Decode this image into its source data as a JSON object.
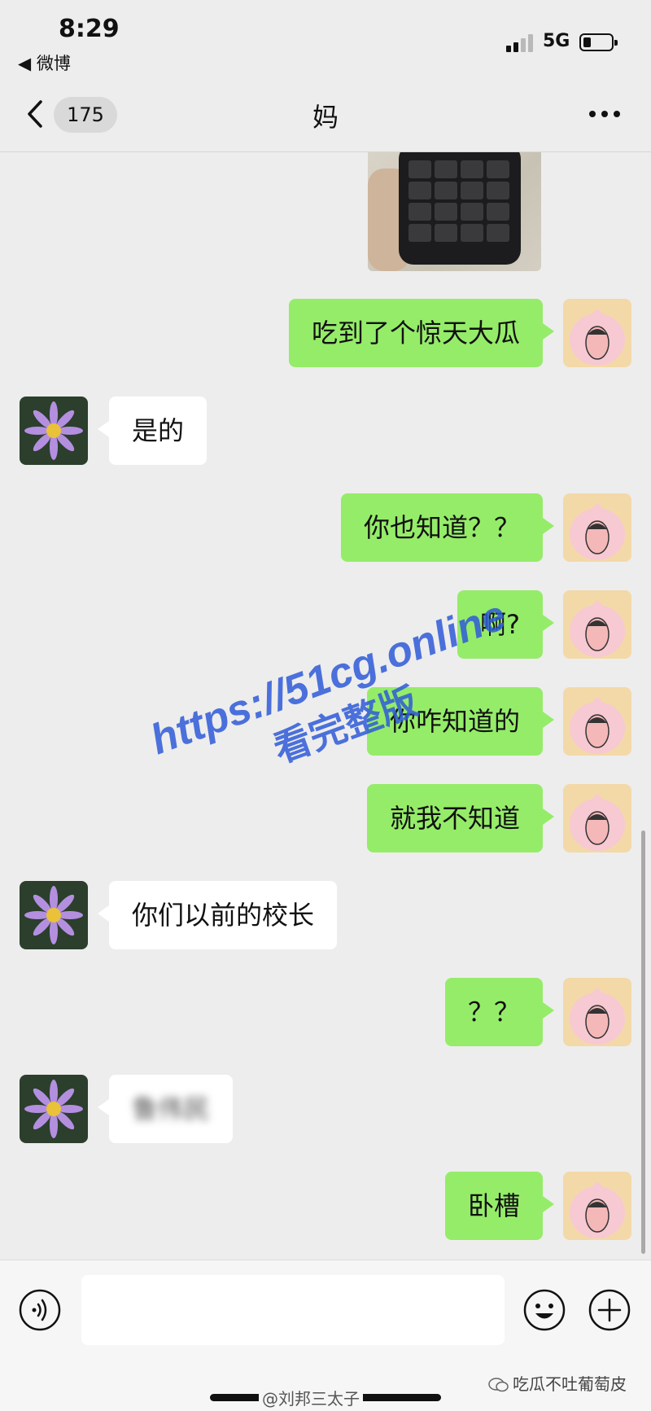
{
  "status_bar": {
    "time": "8:29",
    "back_app": "◀ 微博",
    "network": "5G",
    "signal_bars": 2,
    "signal_bars_total": 4,
    "battery_fraction": 0.25
  },
  "nav": {
    "unread_count": "175",
    "title": "妈",
    "back_icon": "chevron-left-icon",
    "more_icon": "more-dots-icon"
  },
  "messages": [
    {
      "side": "out",
      "text": "吃到了个惊天大瓜"
    },
    {
      "side": "in",
      "text": "是的"
    },
    {
      "side": "out",
      "text": "你也知道？？"
    },
    {
      "side": "out",
      "text": "啊?"
    },
    {
      "side": "out",
      "text": "你咋知道的"
    },
    {
      "side": "out",
      "text": "就我不知道"
    },
    {
      "side": "in",
      "text": "你们以前的校长"
    },
    {
      "side": "out",
      "text": "？？"
    },
    {
      "side": "in",
      "text": "鲁伟民",
      "blurred": true
    },
    {
      "side": "out",
      "text": "卧槽"
    }
  ],
  "watermark": {
    "url": "https://51cg.online",
    "slogan": "看完整版"
  },
  "input_bar": {
    "placeholder": "",
    "voice_icon": "voice-icon",
    "emoji_icon": "emoji-icon",
    "plus_icon": "plus-icon"
  },
  "credits": {
    "weibo": "@刘邦三太子",
    "wechat": "吃瓜不吐葡萄皮"
  },
  "colors": {
    "background": "#ededed",
    "out_bubble": "#95ec69",
    "in_bubble": "#ffffff",
    "watermark": "#2f5bd8"
  }
}
